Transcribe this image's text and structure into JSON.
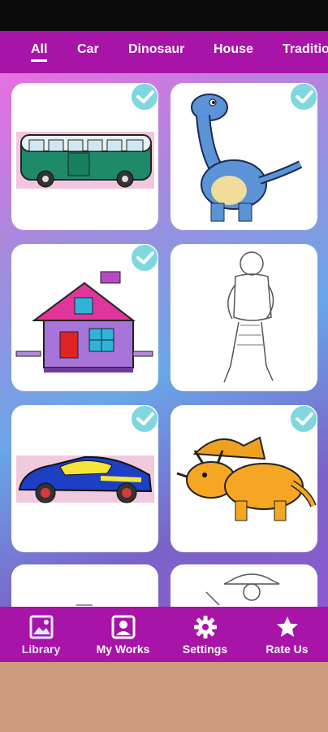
{
  "tabs": [
    {
      "label": "All",
      "active": true
    },
    {
      "label": "Car",
      "active": false
    },
    {
      "label": "Dinosaur",
      "active": false
    },
    {
      "label": "House",
      "active": false
    },
    {
      "label": "Traditio",
      "active": false
    }
  ],
  "cards": [
    {
      "subject": "green-bus",
      "colored": true,
      "checked": true
    },
    {
      "subject": "blue-dinosaur",
      "colored": true,
      "checked": true
    },
    {
      "subject": "pink-house",
      "colored": true,
      "checked": true
    },
    {
      "subject": "warrior-outline",
      "colored": false,
      "checked": false
    },
    {
      "subject": "blue-sports-car",
      "colored": true,
      "checked": true
    },
    {
      "subject": "orange-triceratops",
      "colored": true,
      "checked": true
    },
    {
      "subject": "partial-outline",
      "colored": false,
      "checked": false
    },
    {
      "subject": "cowboy-outline",
      "colored": false,
      "checked": false
    }
  ],
  "nav": [
    {
      "label": "Library",
      "icon": "image-icon",
      "active": true
    },
    {
      "label": "My Works",
      "icon": "portrait-icon",
      "active": false
    },
    {
      "label": "Settings",
      "icon": "gear-icon",
      "active": false
    },
    {
      "label": "Rate Us",
      "icon": "star-icon",
      "active": false
    }
  ],
  "colors": {
    "primary": "#a813a8",
    "check": "#7fd7df",
    "bottom": "#cf9b7f"
  }
}
